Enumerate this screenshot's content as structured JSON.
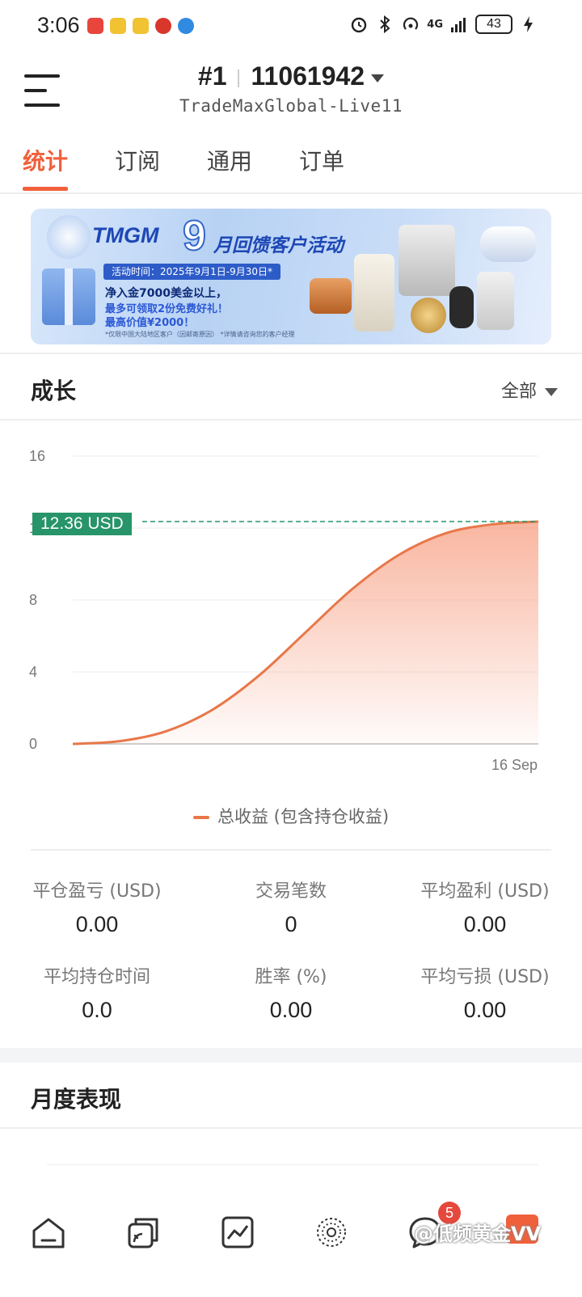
{
  "status_bar": {
    "time": "3:06",
    "network": "4G",
    "battery": "43"
  },
  "header": {
    "account_prefix": "#1",
    "account_number": "11061942",
    "server": "TradeMaxGlobal-Live11"
  },
  "tabs": [
    {
      "label": "统计",
      "active": true
    },
    {
      "label": "订阅",
      "active": false
    },
    {
      "label": "通用",
      "active": false
    },
    {
      "label": "订单",
      "active": false
    }
  ],
  "banner": {
    "brand": "TMGM",
    "big_number": "9",
    "subtitle": "月回馈客户活动",
    "date": "活动时间：2025年9月1日-9月30日*",
    "line1": "净入金7000美金以上，",
    "line2": "最多可领取2份免费好礼！",
    "line3": "最高价值¥2000！",
    "note": "*仅限中国大陆地区客户（因邮寄原因）  *详情请咨询您的客户经理"
  },
  "growth": {
    "title": "成长",
    "filter_label": "全部",
    "current_value_label": "12.36 USD",
    "legend": "总收益 (包含持仓收益)"
  },
  "chart_data": {
    "type": "area",
    "title": "",
    "xlabel": "",
    "ylabel": "",
    "ylim": [
      0,
      16
    ],
    "y_ticks": [
      "0",
      "4",
      "8",
      "12",
      "16"
    ],
    "x_tick_labels": [
      "16 Sep"
    ],
    "series": [
      {
        "name": "总收益 (包含持仓收益)",
        "x": [
          0,
          0.1,
          0.2,
          0.3,
          0.4,
          0.5,
          0.6,
          0.7,
          0.8,
          0.9,
          1.0
        ],
        "values": [
          0,
          0.15,
          0.7,
          1.9,
          3.8,
          6.2,
          8.6,
          10.5,
          11.7,
          12.2,
          12.36
        ]
      }
    ],
    "current_value": 12.36,
    "line_color": "#e87749",
    "grid": true
  },
  "stats": [
    {
      "label": "平仓盈亏 (USD)",
      "value": "0.00"
    },
    {
      "label": "交易笔数",
      "value": "0"
    },
    {
      "label": "平均盈利 (USD)",
      "value": "0.00"
    },
    {
      "label": "平均持仓时间",
      "value": "0.0"
    },
    {
      "label": "胜率 (%)",
      "value": "0.00"
    },
    {
      "label": "平均亏损 (USD)",
      "value": "0.00"
    }
  ],
  "monthly": {
    "title": "月度表现"
  },
  "bottom_nav": {
    "items": [
      "home-icon",
      "copy-trade-icon",
      "chart-icon",
      "discover-icon",
      "message-icon"
    ],
    "message_badge": "5"
  },
  "watermark": "@低频黄金VV",
  "colors": {
    "accent": "#f0603a",
    "line": "#e87749",
    "tag": "#27946a"
  }
}
